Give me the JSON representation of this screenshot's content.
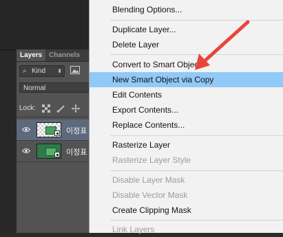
{
  "layers_panel": {
    "tabs": [
      {
        "label": "Layers",
        "active": true
      },
      {
        "label": "Channels",
        "active": false
      }
    ],
    "filter": {
      "kind_label": "Kind"
    },
    "blend_mode": "Normal",
    "lock_label": "Lock:",
    "layers": [
      {
        "name": "이정표",
        "selected": true,
        "thumbnail": "transparent-checker"
      },
      {
        "name": "이정표",
        "selected": false,
        "thumbnail": "green-sign"
      }
    ]
  },
  "context_menu": {
    "items": [
      {
        "label": "Blending Options...",
        "enabled": true,
        "highlighted": false
      },
      {
        "label": "Duplicate Layer...",
        "enabled": true,
        "highlighted": false
      },
      {
        "label": "Delete Layer",
        "enabled": true,
        "highlighted": false
      },
      {
        "label": "Convert to Smart Object",
        "enabled": true,
        "highlighted": false
      },
      {
        "label": "New Smart Object via Copy",
        "enabled": true,
        "highlighted": true
      },
      {
        "label": "Edit Contents",
        "enabled": true,
        "highlighted": false
      },
      {
        "label": "Export Contents...",
        "enabled": true,
        "highlighted": false
      },
      {
        "label": "Replace Contents...",
        "enabled": true,
        "highlighted": false
      },
      {
        "label": "Rasterize Layer",
        "enabled": true,
        "highlighted": false
      },
      {
        "label": "Rasterize Layer Style",
        "enabled": false,
        "highlighted": false
      },
      {
        "label": "Disable Layer Mask",
        "enabled": false,
        "highlighted": false
      },
      {
        "label": "Disable Vector Mask",
        "enabled": false,
        "highlighted": false
      },
      {
        "label": "Create Clipping Mask",
        "enabled": true,
        "highlighted": false
      },
      {
        "label": "Link Layers",
        "enabled": false,
        "highlighted": false
      }
    ]
  },
  "colors": {
    "highlight": "#91c9f7",
    "annotation_arrow": "#e8453c",
    "selected_layer": "#5d6a7c"
  }
}
